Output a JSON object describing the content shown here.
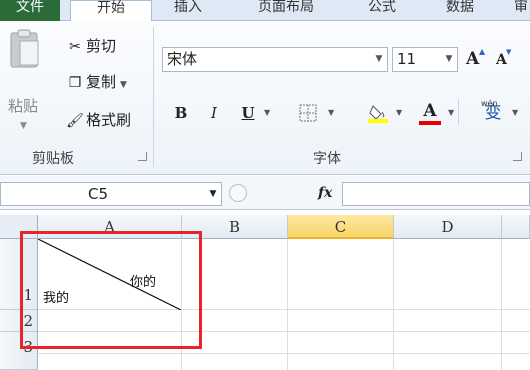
{
  "tabs": [
    "文件",
    "开始",
    "插入",
    "页面布局",
    "公式",
    "数据",
    "审"
  ],
  "clipboard": {
    "paste": "粘贴",
    "cut": "剪切",
    "copy": "复制",
    "format_painter": "格式刷",
    "group_label": "剪贴板"
  },
  "font": {
    "name": "宋体",
    "size": "11",
    "grow": "A",
    "shrink": "A",
    "bold": "B",
    "italic": "I",
    "underline": "U",
    "font_color_glyph": "A",
    "phonetic": "变",
    "phonetic_small": "wén",
    "group_label": "字体",
    "highlight_color": "#ffff00",
    "font_color": "#e60000"
  },
  "formula_bar": {
    "name_box": "C5",
    "fx": "fx",
    "value": ""
  },
  "grid": {
    "columns": [
      "A",
      "B",
      "C",
      "D"
    ],
    "rows": [
      "1",
      "2",
      "3"
    ],
    "selected_column": "C",
    "a1_top_right": "你的",
    "a1_bottom_left": "我的"
  },
  "colors": {
    "file_tab": "#2a6b39",
    "highlight_border": "#e8232a",
    "selected_header": "#f9d466"
  }
}
